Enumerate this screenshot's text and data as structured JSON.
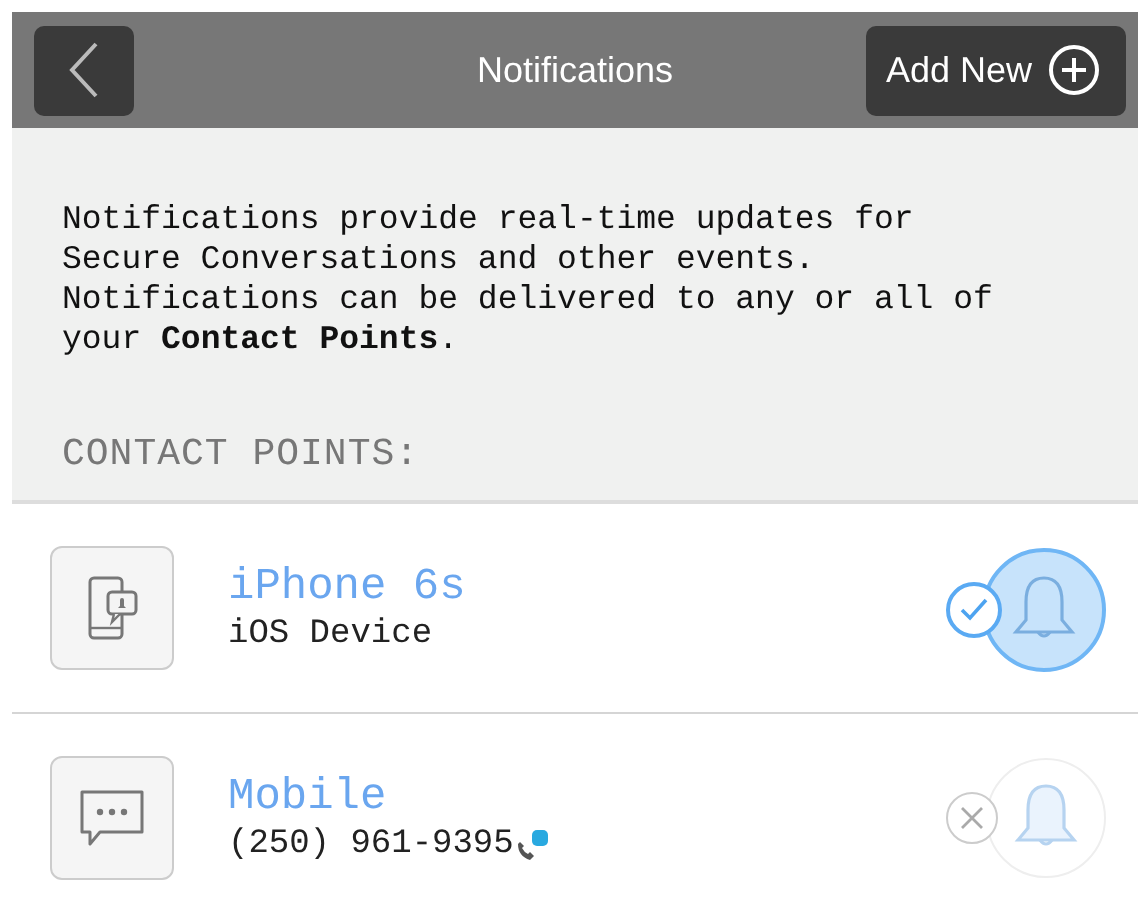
{
  "header": {
    "title": "Notifications",
    "add_button": "Add New"
  },
  "intro": "Notifications provide real-time updates for Secure Conversations and other events. Notifications can be delivered to any or all of your **Contact Points**.",
  "section_title": "CONTACT POINTS:",
  "contact_points": [
    {
      "kind": "device",
      "name": "iPhone 6s",
      "detail": "iOS Device",
      "on": true
    },
    {
      "kind": "phone",
      "name": "Mobile",
      "detail": "(250) 961-9395",
      "on": false
    }
  ]
}
